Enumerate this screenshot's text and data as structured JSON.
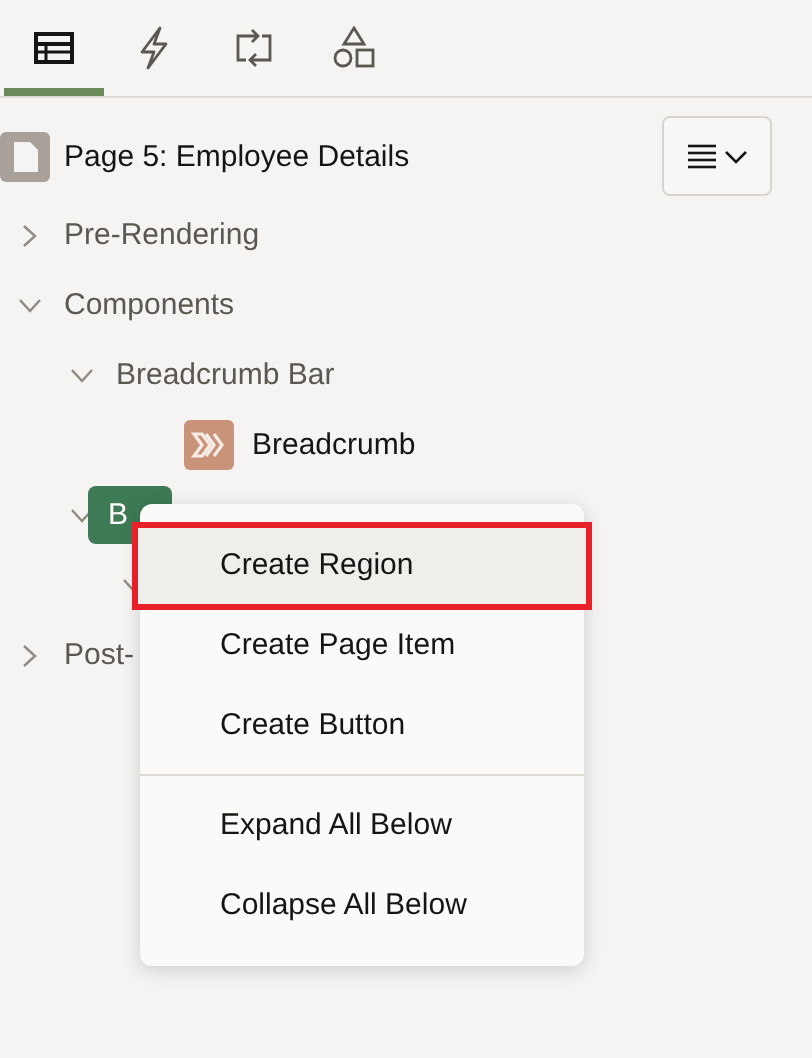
{
  "tabs": [
    {
      "kind": "layout",
      "selected": true
    },
    {
      "kind": "lightning",
      "selected": false
    },
    {
      "kind": "sync",
      "selected": false
    },
    {
      "kind": "shapes",
      "selected": false
    }
  ],
  "header": {
    "title": "Page 5: Employee Details"
  },
  "tree": [
    {
      "label": "Pre-Rendering",
      "expanded": false,
      "selected": false
    },
    {
      "label": "Components",
      "expanded": true,
      "selected": false,
      "children": [
        {
          "label": "Breadcrumb Bar",
          "expanded": true,
          "selected": false,
          "children": [
            {
              "label": "Breadcrumb",
              "kind": "breadcrumb",
              "selected": false
            }
          ]
        },
        {
          "label": "B",
          "expanded": true,
          "selected": true,
          "children": [
            {
              "expanded": true
            }
          ]
        }
      ]
    },
    {
      "label": "Post-",
      "expanded": false,
      "selected": false
    }
  ],
  "context_menu": {
    "groups": [
      [
        {
          "label": "Create Region",
          "selected": true,
          "outlined": true
        },
        {
          "label": "Create Page Item",
          "selected": false,
          "outlined": false
        },
        {
          "label": "Create Button",
          "selected": false,
          "outlined": false
        }
      ],
      [
        {
          "label": "Expand All Below",
          "selected": false,
          "outlined": false
        },
        {
          "label": "Collapse All Below",
          "selected": false,
          "outlined": false
        }
      ]
    ]
  }
}
